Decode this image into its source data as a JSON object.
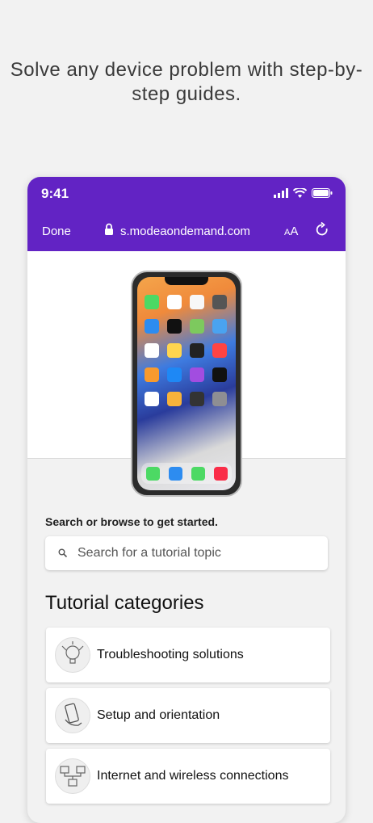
{
  "headline": "Solve any device problem with step-by-step guides.",
  "status": {
    "time": "9:41"
  },
  "browser": {
    "done_label": "Done",
    "url": "s.modeaondemand.com",
    "text_size_label_small": "A",
    "text_size_label_large": "A"
  },
  "colors": {
    "brand": "#6223c4",
    "background": "#f2f2f2",
    "card": "#ffffff"
  },
  "search": {
    "prompt": "Search or browse to get started.",
    "placeholder": "Search for a tutorial topic",
    "value": ""
  },
  "categories": {
    "title": "Tutorial categories",
    "items": [
      {
        "label": "Troubleshooting solutions",
        "icon": "troubleshooting-icon"
      },
      {
        "label": "Setup and orientation",
        "icon": "hand-phone-icon"
      },
      {
        "label": "Internet and wireless connections",
        "icon": "network-devices-icon"
      }
    ]
  }
}
